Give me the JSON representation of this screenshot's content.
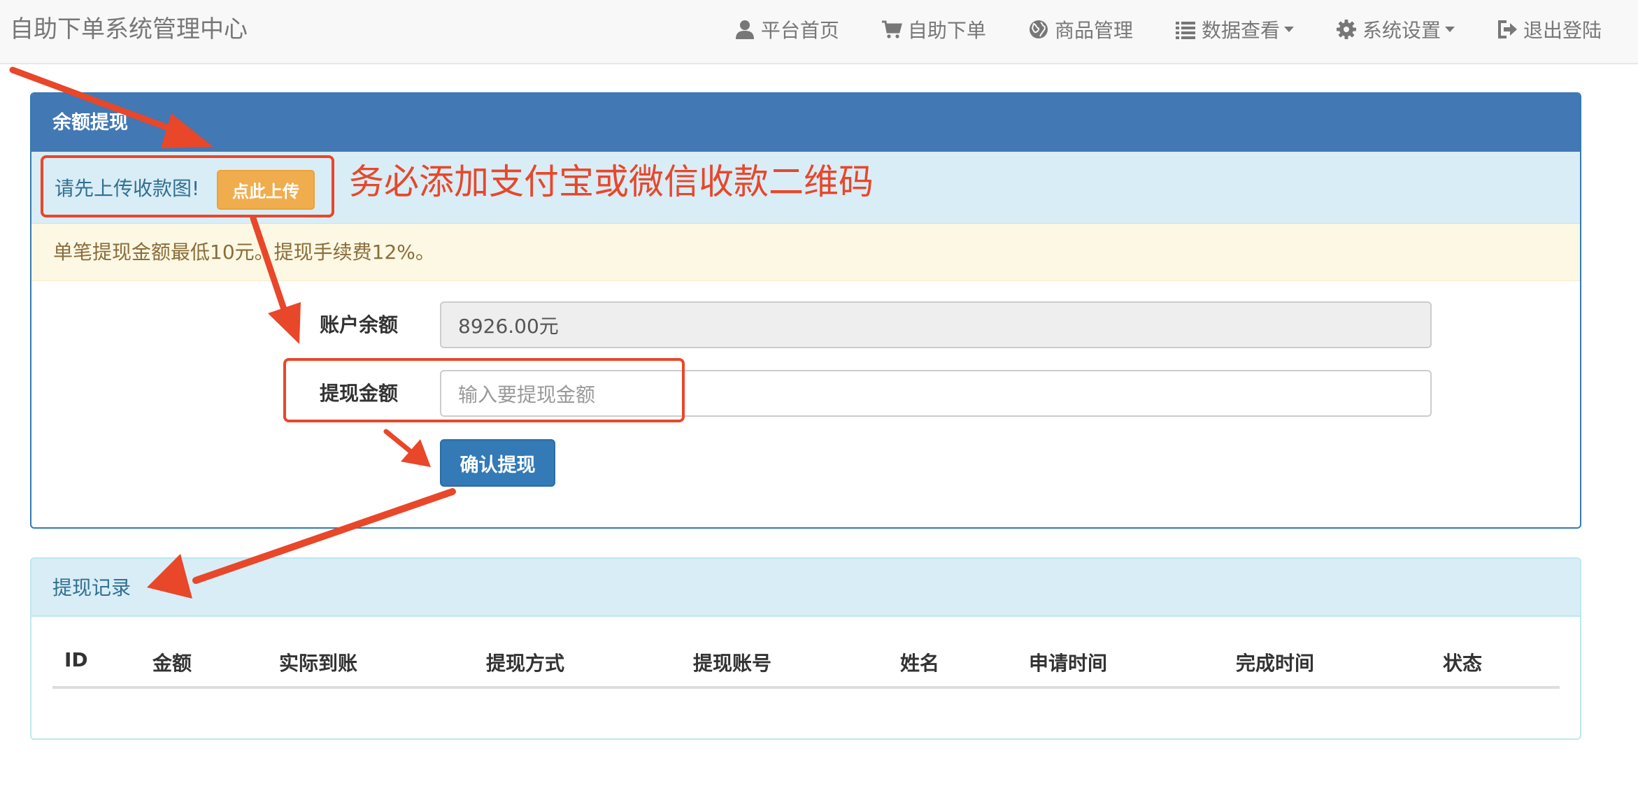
{
  "navbar": {
    "brand": "自助下单系统管理中心",
    "items": [
      {
        "label": "平台首页",
        "icon": "user-icon",
        "dropdown": false
      },
      {
        "label": "自助下单",
        "icon": "cart-icon",
        "dropdown": false
      },
      {
        "label": "商品管理",
        "icon": "globe-icon",
        "dropdown": false
      },
      {
        "label": "数据查看",
        "icon": "list-icon",
        "dropdown": true
      },
      {
        "label": "系统设置",
        "icon": "gear-icon",
        "dropdown": true
      },
      {
        "label": "退出登陆",
        "icon": "logout-icon",
        "dropdown": false
      }
    ]
  },
  "withdraw_panel": {
    "title": "余额提现",
    "upload_prompt": "请先上传收款图!",
    "upload_button": "点此上传",
    "notice": "单笔提现金额最低10元。提现手续费12%。",
    "balance_label": "账户余额",
    "balance_value": "8926.00元",
    "amount_label": "提现金额",
    "amount_placeholder": "输入要提现金额",
    "submit_button": "确认提现"
  },
  "annotation": {
    "text": "务必添加支付宝或微信收款二维码",
    "color": "#e8472a"
  },
  "records_panel": {
    "title": "提现记录",
    "columns": [
      "ID",
      "金额",
      "实际到账",
      "提现方式",
      "提现账号",
      "姓名",
      "申请时间",
      "完成时间",
      "状态"
    ],
    "rows": []
  },
  "colors": {
    "primary": "#337ab7",
    "warning_button": "#f0ad4e",
    "info_bg": "#d9edf7",
    "warning_bg": "#fcf8e3"
  }
}
